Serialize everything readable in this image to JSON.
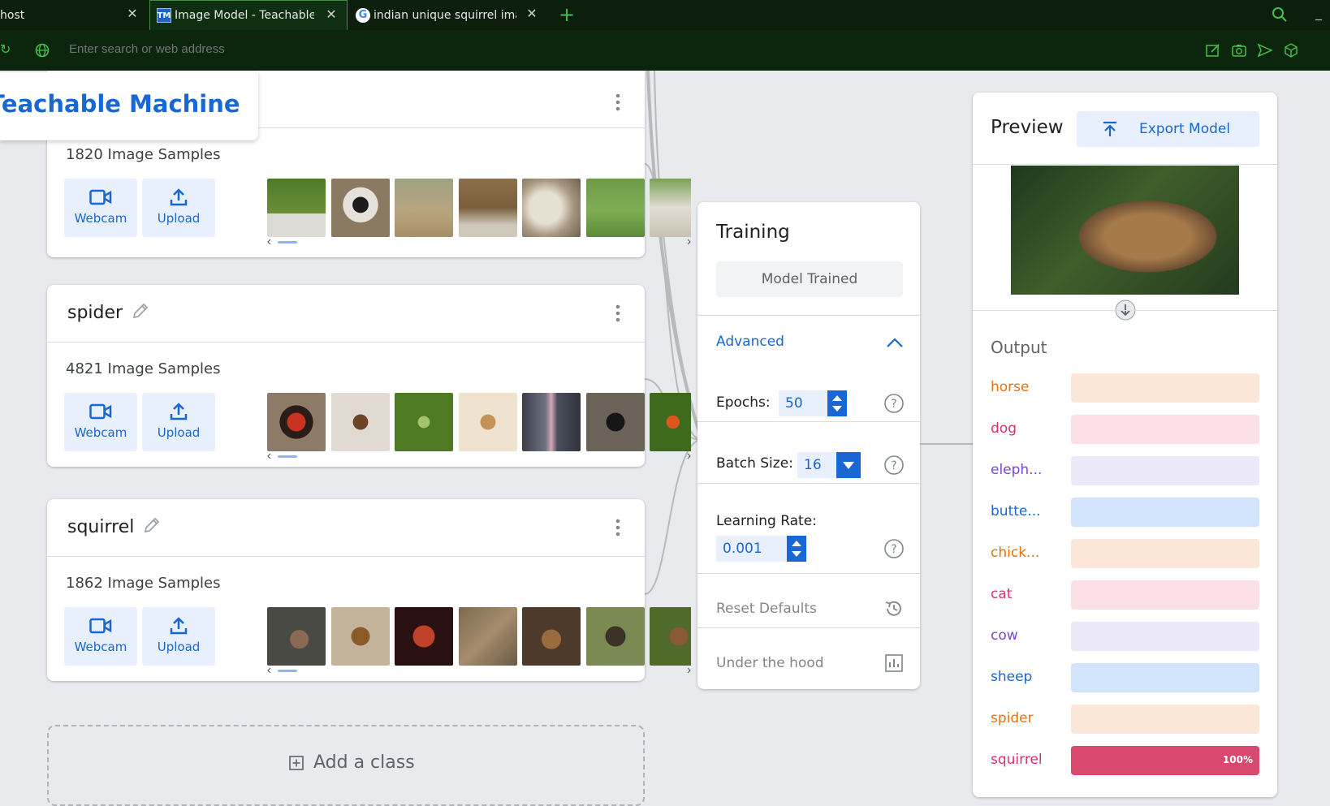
{
  "browser": {
    "tabs": [
      {
        "title": "host"
      },
      {
        "title": "Image Model - Teachable Machine"
      },
      {
        "title": "indian unique squirrel images"
      }
    ],
    "tab_favicon_tm": "TM",
    "tab_favicon_g": "G",
    "new_tab_label": "+",
    "address_placeholder": "Enter search or web address"
  },
  "app": {
    "brand": "Teachable Machine"
  },
  "classes": [
    {
      "name": "",
      "samples": "1820 Image Samples",
      "webcam_label": "Webcam",
      "upload_label": "Upload"
    },
    {
      "name": "spider",
      "samples": "4821 Image Samples",
      "webcam_label": "Webcam",
      "upload_label": "Upload"
    },
    {
      "name": "squirrel",
      "samples": "1862 Image Samples",
      "webcam_label": "Webcam",
      "upload_label": "Upload"
    }
  ],
  "add_class_label": "Add a class",
  "training": {
    "title": "Training",
    "button_label": "Model Trained",
    "advanced_label": "Advanced",
    "epochs_label": "Epochs:",
    "epochs_value": "50",
    "batch_label": "Batch Size:",
    "batch_value": "16",
    "lr_label": "Learning Rate:",
    "lr_value": "0.001",
    "reset_label": "Reset Defaults",
    "hood_label": "Under the hood"
  },
  "preview": {
    "title": "Preview",
    "export_label": "Export Model",
    "output_title": "Output",
    "outputs": [
      {
        "label": "horse",
        "color": "#e8710a",
        "bg": "#fde7d9",
        "fill": 0,
        "pct": ""
      },
      {
        "label": "dog",
        "color": "#d93070",
        "bg": "#fde0e6",
        "fill": 0,
        "pct": ""
      },
      {
        "label": "eleph...",
        "color": "#7b44d8",
        "bg": "#ece9fb",
        "fill": 0,
        "pct": ""
      },
      {
        "label": "butte...",
        "color": "#1967d2",
        "bg": "#d2e3fc",
        "fill": 0,
        "pct": ""
      },
      {
        "label": "chick...",
        "color": "#e8710a",
        "bg": "#fde7d9",
        "fill": 0,
        "pct": ""
      },
      {
        "label": "cat",
        "color": "#d93070",
        "bg": "#fde0e6",
        "fill": 0,
        "pct": ""
      },
      {
        "label": "cow",
        "color": "#7b44d8",
        "bg": "#ece9fb",
        "fill": 0,
        "pct": ""
      },
      {
        "label": "sheep",
        "color": "#1967d2",
        "bg": "#d2e3fc",
        "fill": 0,
        "pct": ""
      },
      {
        "label": "spider",
        "color": "#e8710a",
        "bg": "#fde7d9",
        "fill": 0,
        "pct": ""
      },
      {
        "label": "squirrel",
        "color": "#d93070",
        "bg": "#fde0e6",
        "fill": 1,
        "pct": "100%",
        "fill_color": "#d9486e"
      }
    ]
  }
}
